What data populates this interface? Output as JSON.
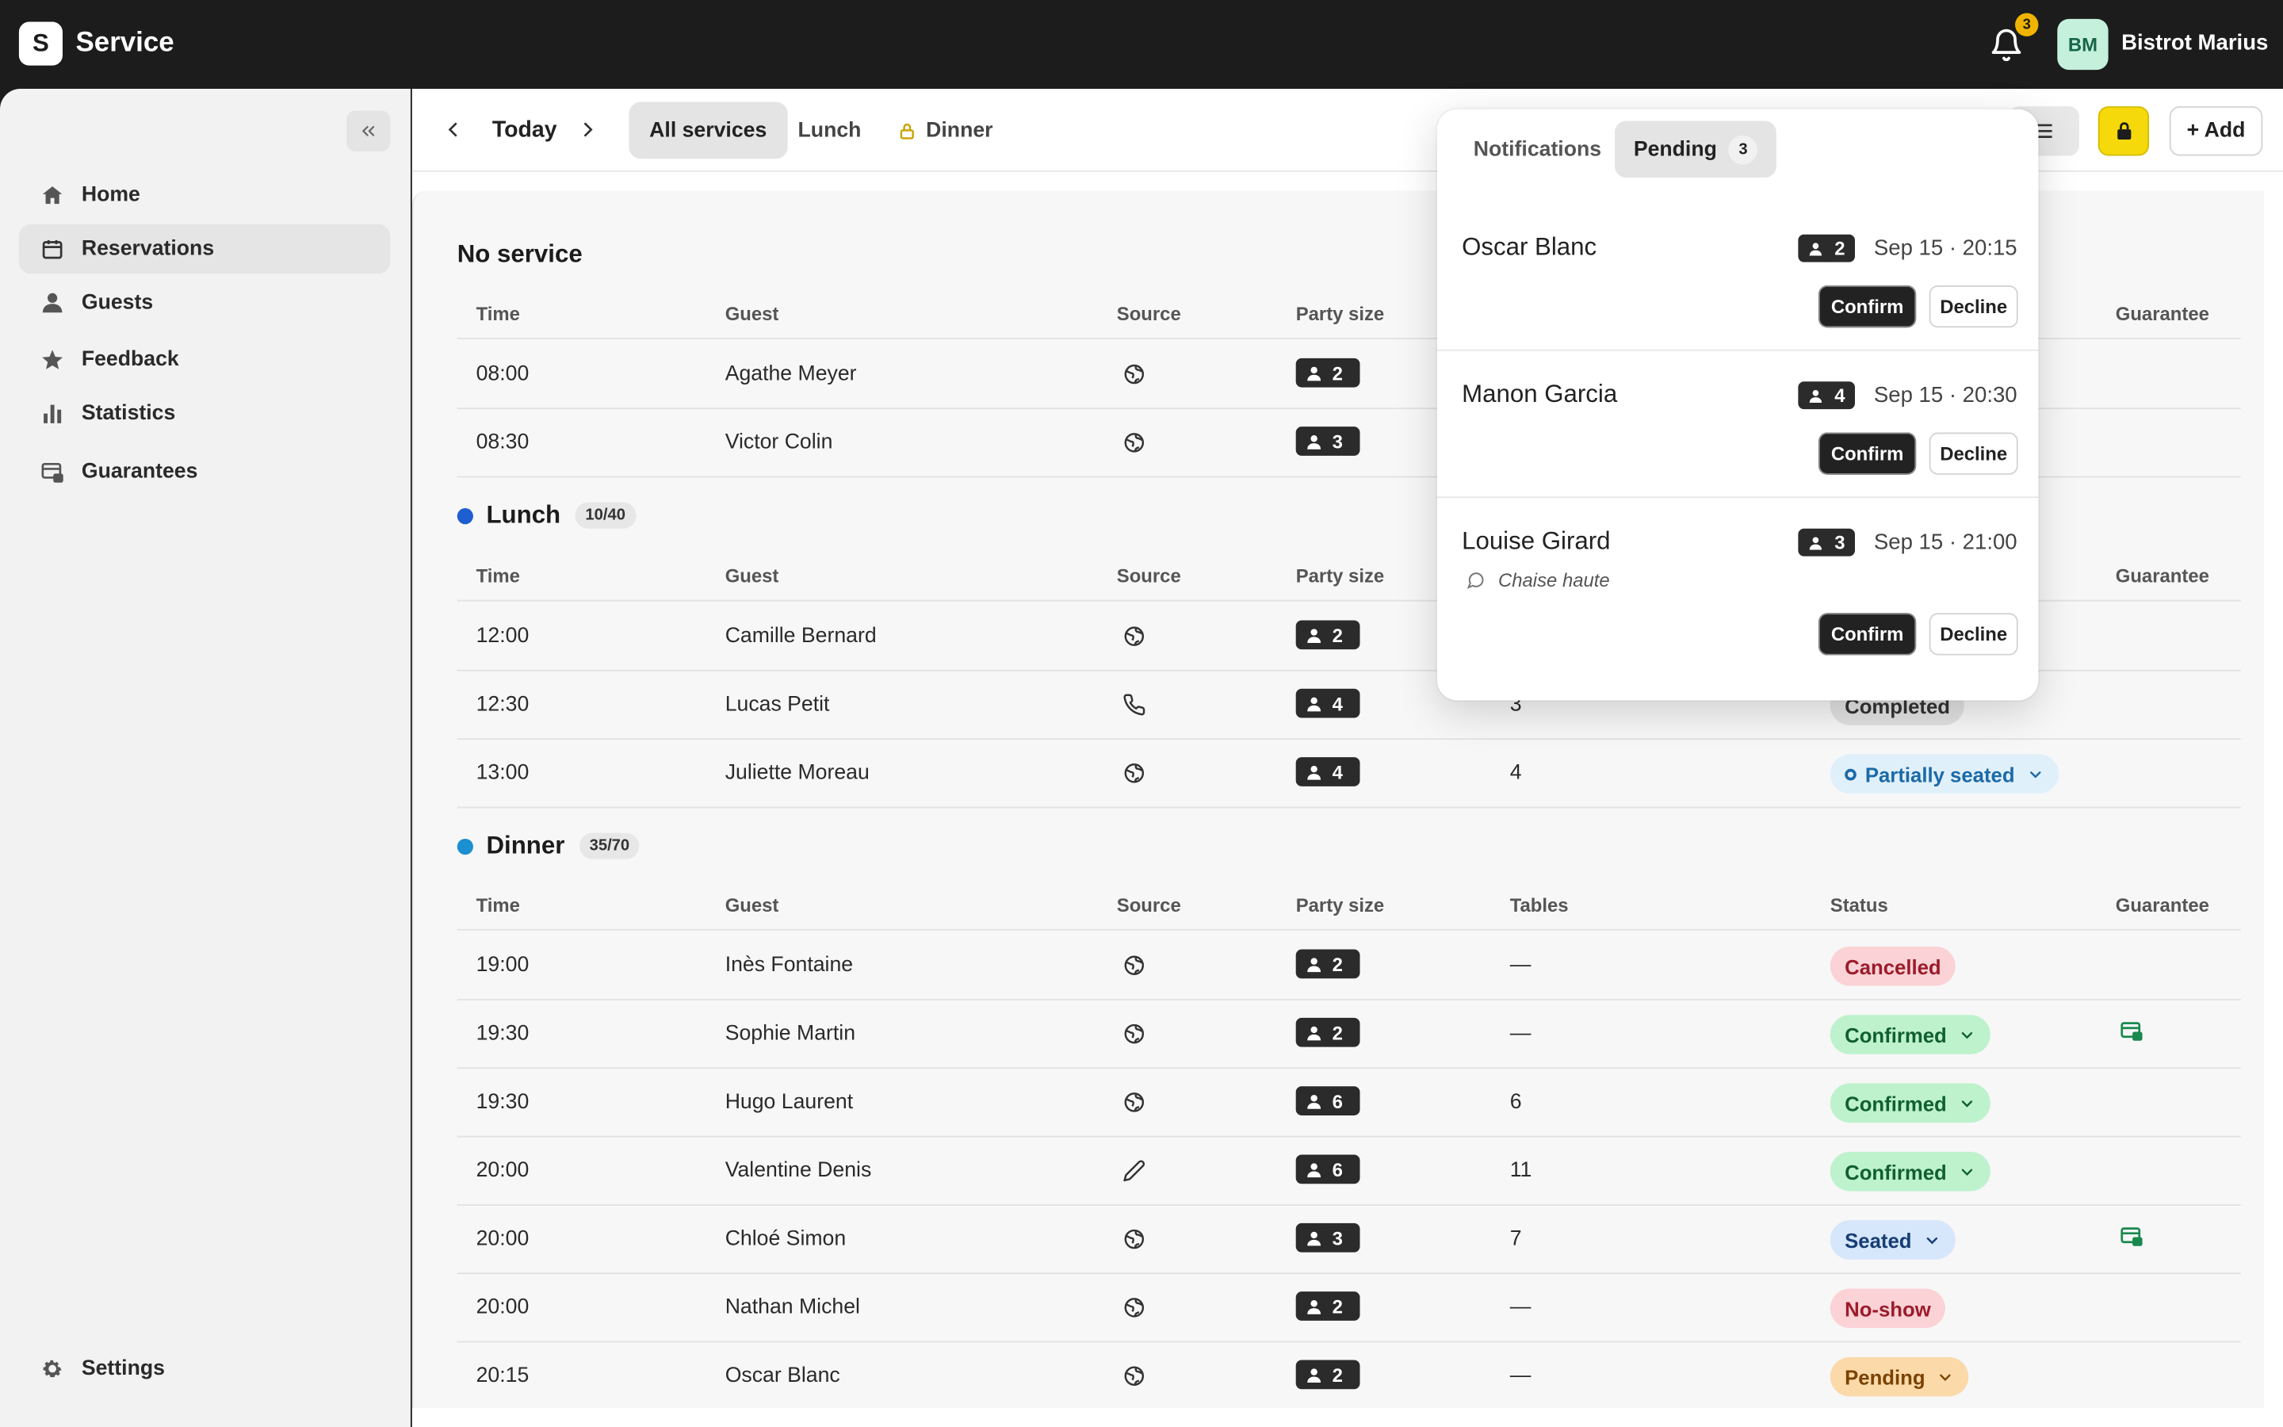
{
  "app": {
    "logo_letter": "S",
    "name": "Service"
  },
  "header": {
    "notification_count": "3",
    "avatar_initials": "BM",
    "account_name": "Bistrot Marius"
  },
  "sidebar": {
    "items": [
      {
        "label": "Home",
        "icon": "home-icon"
      },
      {
        "label": "Reservations",
        "icon": "calendar-icon",
        "active": true
      },
      {
        "label": "Guests",
        "icon": "person-icon"
      },
      {
        "label": "Feedback",
        "icon": "star-icon"
      },
      {
        "label": "Statistics",
        "icon": "bar-chart-icon"
      },
      {
        "label": "Guarantees",
        "icon": "card-lock-icon"
      }
    ],
    "settings_label": "Settings"
  },
  "toolbar": {
    "date_label": "Today",
    "tabs": [
      "All services",
      "Lunch",
      "Dinner"
    ],
    "add_label": "+ Add",
    "lock_color": "#f5d90a"
  },
  "columns": {
    "time": "Time",
    "guest": "Guest",
    "source": "Source",
    "party": "Party size",
    "tables": "Tables",
    "status": "Status",
    "guarantee": "Guarantee"
  },
  "sections": {
    "none": {
      "title": "No service",
      "rows": [
        {
          "time": "08:00",
          "guest": "Agathe Meyer",
          "source": "web",
          "party": "2"
        },
        {
          "time": "08:30",
          "guest": "Victor Colin",
          "source": "web",
          "party": "3"
        }
      ]
    },
    "lunch": {
      "title": "Lunch",
      "capacity": "10/40",
      "color": "#1d5fd1",
      "rows": [
        {
          "time": "12:00",
          "guest": "Camille Bernard",
          "source": "web",
          "party": "2"
        },
        {
          "time": "12:30",
          "guest": "Lucas Petit",
          "source": "phone",
          "party": "4",
          "tables": "3",
          "status": "Completed"
        },
        {
          "time": "13:00",
          "guest": "Juliette Moreau",
          "source": "web",
          "party": "4",
          "tables": "4",
          "status": "Partially seated"
        }
      ]
    },
    "dinner": {
      "title": "Dinner",
      "capacity": "35/70",
      "color": "#1a8fd1",
      "rows": [
        {
          "time": "19:00",
          "guest": "Inès Fontaine",
          "source": "web",
          "party": "2",
          "tables": "—",
          "status": "Cancelled"
        },
        {
          "time": "19:30",
          "guest": "Sophie Martin",
          "source": "web",
          "party": "2",
          "tables": "—",
          "status": "Confirmed",
          "guarantee": true
        },
        {
          "time": "19:30",
          "guest": "Hugo Laurent",
          "source": "web",
          "party": "6",
          "tables": "6",
          "status": "Confirmed"
        },
        {
          "time": "20:00",
          "guest": "Valentine Denis",
          "source": "manual",
          "party": "6",
          "tables": "11",
          "status": "Confirmed"
        },
        {
          "time": "20:00",
          "guest": "Chloé Simon",
          "source": "web",
          "party": "3",
          "tables": "7",
          "status": "Seated",
          "guarantee": true
        },
        {
          "time": "20:00",
          "guest": "Nathan Michel",
          "source": "web",
          "party": "2",
          "tables": "—",
          "status": "No-show"
        },
        {
          "time": "20:15",
          "guest": "Oscar Blanc",
          "source": "web",
          "party": "2",
          "tables": "—",
          "status": "Pending"
        }
      ]
    }
  },
  "popover": {
    "tab_notifications": "Notifications",
    "tab_pending": "Pending",
    "pending_count": "3",
    "confirm_label": "Confirm",
    "decline_label": "Decline",
    "items": [
      {
        "name": "Oscar Blanc",
        "party": "2",
        "datetime": "Sep 15 · 20:15"
      },
      {
        "name": "Manon Garcia",
        "party": "4",
        "datetime": "Sep 15 · 20:30"
      },
      {
        "name": "Louise Girard",
        "party": "3",
        "datetime": "Sep 15 · 21:00",
        "note": "Chaise haute"
      }
    ]
  }
}
